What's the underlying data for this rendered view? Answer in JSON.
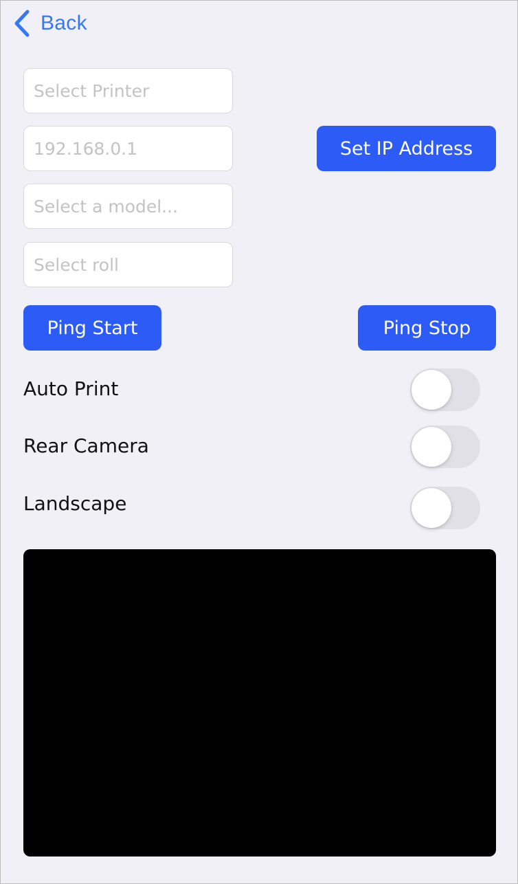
{
  "nav": {
    "back_label": "Back",
    "back_icon": "chevron-left-icon"
  },
  "form": {
    "printer": {
      "placeholder": "Select Printer",
      "value": ""
    },
    "ip_address": {
      "placeholder": "192.168.0.1",
      "value": ""
    },
    "model": {
      "placeholder": "Select a model...",
      "value": ""
    },
    "roll": {
      "placeholder": "Select roll",
      "value": ""
    }
  },
  "buttons": {
    "set_ip": "Set IP Address",
    "ping_start": "Ping Start",
    "ping_stop": "Ping Stop"
  },
  "toggles": [
    {
      "label": "Auto Print",
      "on": false
    },
    {
      "label": "Rear Camera",
      "on": false
    },
    {
      "label": "Landscape",
      "on": false
    }
  ],
  "colors": {
    "accent": "#2d5bf6",
    "link": "#3478f6",
    "background": "#f1f0f6",
    "toggle_off": "#e1e0e6",
    "preview": "#000000"
  }
}
